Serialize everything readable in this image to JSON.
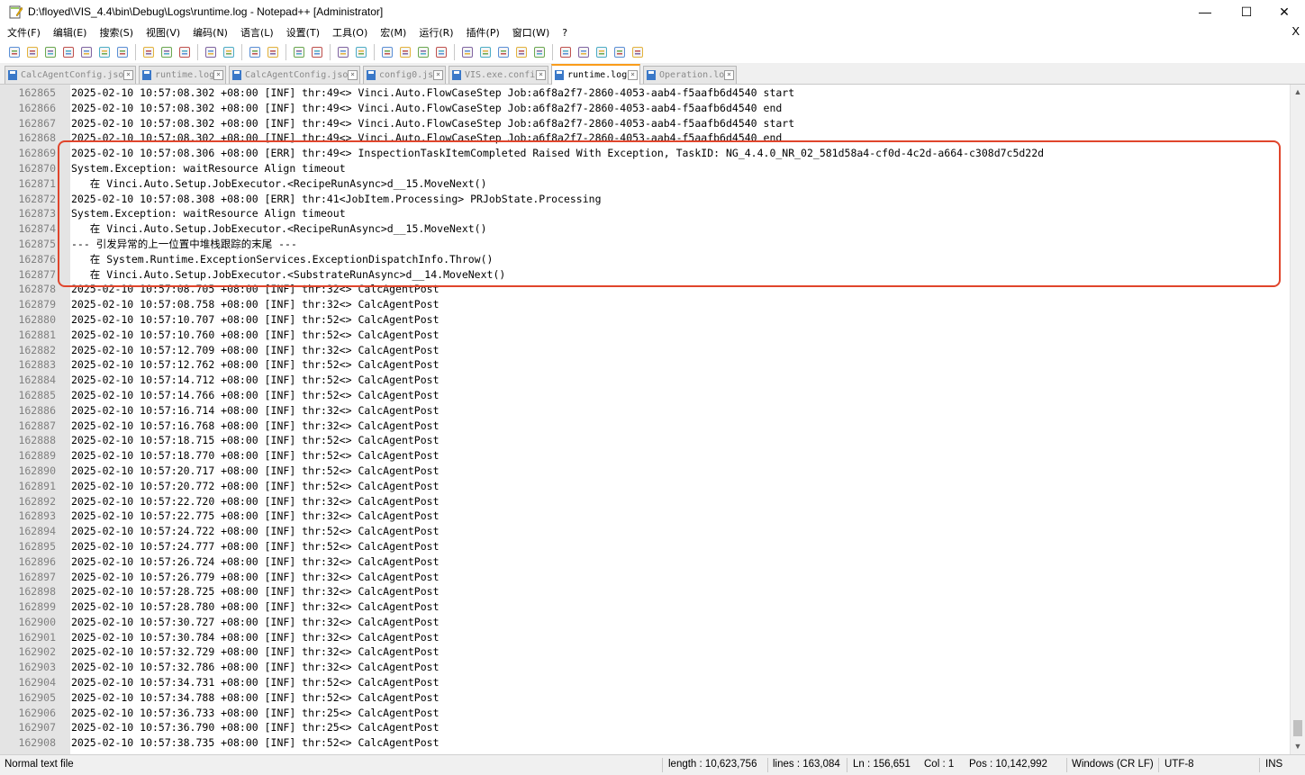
{
  "window": {
    "title": "D:\\floyed\\VIS_4.4\\bin\\Debug\\Logs\\runtime.log - Notepad++ [Administrator]",
    "minimize_label": "—",
    "maximize_label": "☐",
    "close_label": "✕"
  },
  "menu": {
    "items": [
      "文件(F)",
      "编辑(E)",
      "搜索(S)",
      "视图(V)",
      "编码(N)",
      "语言(L)",
      "设置(T)",
      "工具(O)",
      "宏(M)",
      "运行(R)",
      "插件(P)",
      "窗口(W)",
      "?"
    ],
    "close_doc": "X"
  },
  "toolbar": {
    "icons": [
      "new-file-icon",
      "open-file-icon",
      "save-icon",
      "save-all-icon",
      "close-icon",
      "close-all-icon",
      "print-icon",
      "cut-icon",
      "copy-icon",
      "paste-icon",
      "undo-icon",
      "redo-icon",
      "find-icon",
      "replace-icon",
      "zoom-in-icon",
      "zoom-out-icon",
      "sync-vertical-icon",
      "sync-horizontal-icon",
      "word-wrap-icon",
      "show-all-chars-icon",
      "indent-guide-icon",
      "udl-icon",
      "doc-map-icon",
      "doc-list-icon",
      "function-list-icon",
      "folder-workspace-icon",
      "monitoring-icon",
      "record-macro-icon",
      "stop-macro-icon",
      "play-macro-icon",
      "run-macro-multiple-icon",
      "save-macro-icon"
    ]
  },
  "tabs": [
    {
      "label": "CalcAgentConfig.json",
      "active": false
    },
    {
      "label": "runtime.log",
      "active": false
    },
    {
      "label": "CalcAgentConfig.json",
      "active": false
    },
    {
      "label": "config0.js",
      "active": false
    },
    {
      "label": "VIS.exe.config",
      "active": false
    },
    {
      "label": "runtime.log",
      "active": true
    },
    {
      "label": "Operation.log",
      "active": false
    }
  ],
  "editor": {
    "lines": [
      {
        "n": "162865",
        "t": "2025-02-10 10:57:08.302 +08:00 [INF] thr:49<> Vinci.Auto.FlowCaseStep Job:a6f8a2f7-2860-4053-aab4-f5aafb6d4540 start"
      },
      {
        "n": "162866",
        "t": "2025-02-10 10:57:08.302 +08:00 [INF] thr:49<> Vinci.Auto.FlowCaseStep Job:a6f8a2f7-2860-4053-aab4-f5aafb6d4540 end"
      },
      {
        "n": "162867",
        "t": "2025-02-10 10:57:08.302 +08:00 [INF] thr:49<> Vinci.Auto.FlowCaseStep Job:a6f8a2f7-2860-4053-aab4-f5aafb6d4540 start"
      },
      {
        "n": "162868",
        "t": "2025-02-10 10:57:08.302 +08:00 [INF] thr:49<> Vinci.Auto.FlowCaseStep Job:a6f8a2f7-2860-4053-aab4-f5aafb6d4540 end"
      },
      {
        "n": "162869",
        "t": "2025-02-10 10:57:08.306 +08:00 [ERR] thr:49<> InspectionTaskItemCompleted Raised With Exception, TaskID: NG_4.4.0_NR_02_581d58a4-cf0d-4c2d-a664-c308d7c5d22d"
      },
      {
        "n": "162870",
        "t": "System.Exception: waitResource Align timeout"
      },
      {
        "n": "162871",
        "t": "   在 Vinci.Auto.Setup.JobExecutor.<RecipeRunAsync>d__15.MoveNext()"
      },
      {
        "n": "162872",
        "t": "2025-02-10 10:57:08.308 +08:00 [ERR] thr:41<JobItem.Processing> PRJobState.Processing"
      },
      {
        "n": "162873",
        "t": "System.Exception: waitResource Align timeout"
      },
      {
        "n": "162874",
        "t": "   在 Vinci.Auto.Setup.JobExecutor.<RecipeRunAsync>d__15.MoveNext()"
      },
      {
        "n": "162875",
        "t": "--- 引发异常的上一位置中堆栈跟踪的末尾 ---"
      },
      {
        "n": "162876",
        "t": "   在 System.Runtime.ExceptionServices.ExceptionDispatchInfo.Throw()"
      },
      {
        "n": "162877",
        "t": "   在 Vinci.Auto.Setup.JobExecutor.<SubstrateRunAsync>d__14.MoveNext()"
      },
      {
        "n": "162878",
        "t": "2025-02-10 10:57:08.705 +08:00 [INF] thr:32<> CalcAgentPost"
      },
      {
        "n": "162879",
        "t": "2025-02-10 10:57:08.758 +08:00 [INF] thr:32<> CalcAgentPost"
      },
      {
        "n": "162880",
        "t": "2025-02-10 10:57:10.707 +08:00 [INF] thr:52<> CalcAgentPost"
      },
      {
        "n": "162881",
        "t": "2025-02-10 10:57:10.760 +08:00 [INF] thr:52<> CalcAgentPost"
      },
      {
        "n": "162882",
        "t": "2025-02-10 10:57:12.709 +08:00 [INF] thr:32<> CalcAgentPost"
      },
      {
        "n": "162883",
        "t": "2025-02-10 10:57:12.762 +08:00 [INF] thr:52<> CalcAgentPost"
      },
      {
        "n": "162884",
        "t": "2025-02-10 10:57:14.712 +08:00 [INF] thr:52<> CalcAgentPost"
      },
      {
        "n": "162885",
        "t": "2025-02-10 10:57:14.766 +08:00 [INF] thr:52<> CalcAgentPost"
      },
      {
        "n": "162886",
        "t": "2025-02-10 10:57:16.714 +08:00 [INF] thr:32<> CalcAgentPost"
      },
      {
        "n": "162887",
        "t": "2025-02-10 10:57:16.768 +08:00 [INF] thr:32<> CalcAgentPost"
      },
      {
        "n": "162888",
        "t": "2025-02-10 10:57:18.715 +08:00 [INF] thr:52<> CalcAgentPost"
      },
      {
        "n": "162889",
        "t": "2025-02-10 10:57:18.770 +08:00 [INF] thr:52<> CalcAgentPost"
      },
      {
        "n": "162890",
        "t": "2025-02-10 10:57:20.717 +08:00 [INF] thr:52<> CalcAgentPost"
      },
      {
        "n": "162891",
        "t": "2025-02-10 10:57:20.772 +08:00 [INF] thr:52<> CalcAgentPost"
      },
      {
        "n": "162892",
        "t": "2025-02-10 10:57:22.720 +08:00 [INF] thr:32<> CalcAgentPost"
      },
      {
        "n": "162893",
        "t": "2025-02-10 10:57:22.775 +08:00 [INF] thr:32<> CalcAgentPost"
      },
      {
        "n": "162894",
        "t": "2025-02-10 10:57:24.722 +08:00 [INF] thr:52<> CalcAgentPost"
      },
      {
        "n": "162895",
        "t": "2025-02-10 10:57:24.777 +08:00 [INF] thr:52<> CalcAgentPost"
      },
      {
        "n": "162896",
        "t": "2025-02-10 10:57:26.724 +08:00 [INF] thr:32<> CalcAgentPost"
      },
      {
        "n": "162897",
        "t": "2025-02-10 10:57:26.779 +08:00 [INF] thr:32<> CalcAgentPost"
      },
      {
        "n": "162898",
        "t": "2025-02-10 10:57:28.725 +08:00 [INF] thr:32<> CalcAgentPost"
      },
      {
        "n": "162899",
        "t": "2025-02-10 10:57:28.780 +08:00 [INF] thr:32<> CalcAgentPost"
      },
      {
        "n": "162900",
        "t": "2025-02-10 10:57:30.727 +08:00 [INF] thr:32<> CalcAgentPost"
      },
      {
        "n": "162901",
        "t": "2025-02-10 10:57:30.784 +08:00 [INF] thr:32<> CalcAgentPost"
      },
      {
        "n": "162902",
        "t": "2025-02-10 10:57:32.729 +08:00 [INF] thr:32<> CalcAgentPost"
      },
      {
        "n": "162903",
        "t": "2025-02-10 10:57:32.786 +08:00 [INF] thr:32<> CalcAgentPost"
      },
      {
        "n": "162904",
        "t": "2025-02-10 10:57:34.731 +08:00 [INF] thr:52<> CalcAgentPost"
      },
      {
        "n": "162905",
        "t": "2025-02-10 10:57:34.788 +08:00 [INF] thr:52<> CalcAgentPost"
      },
      {
        "n": "162906",
        "t": "2025-02-10 10:57:36.733 +08:00 [INF] thr:25<> CalcAgentPost"
      },
      {
        "n": "162907",
        "t": "2025-02-10 10:57:36.790 +08:00 [INF] thr:25<> CalcAgentPost"
      },
      {
        "n": "162908",
        "t": "2025-02-10 10:57:38.735 +08:00 [INF] thr:52<> CalcAgentPost"
      }
    ]
  },
  "status": {
    "file_type": "Normal text file",
    "length": "length : 10,623,756",
    "lines": "lines : 163,084",
    "ln": "Ln : 156,651",
    "col": "Col : 1",
    "pos": "Pos : 10,142,992",
    "eol": "Windows (CR LF)",
    "encoding": "UTF-8",
    "mode": "INS"
  },
  "colors": {
    "highlight_border": "#e0452c",
    "active_tab_accent": "#fa9c1a",
    "gutter_bg": "#e4e4e4"
  }
}
